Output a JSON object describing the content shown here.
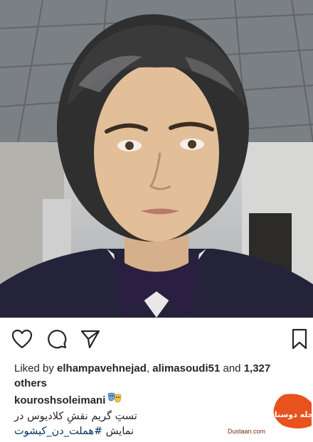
{
  "post": {
    "liked_by_prefix": "Liked by",
    "liker_1": "elhampavehnejad",
    "liker_2": "alimasoudi51",
    "and_word": "and",
    "others_count": "1,327",
    "others_word": "others"
  },
  "caption": {
    "username": "kouroshsoleimani",
    "line_1": "تستِ گریم نقشِ کلادیوس در",
    "line_2_prefix": "نمایش ",
    "hashtag": "#هملت_دن_کیشوت"
  },
  "actions": {
    "icons": [
      "heart-icon",
      "comment-icon",
      "share-icon",
      "bookmark-icon"
    ]
  },
  "watermark": {
    "logo_text": "مجله دوستان",
    "site": "Dustaan.com"
  },
  "colors": {
    "text": "#262626",
    "hashtag": "#003569",
    "watermark": "#e8521c"
  }
}
